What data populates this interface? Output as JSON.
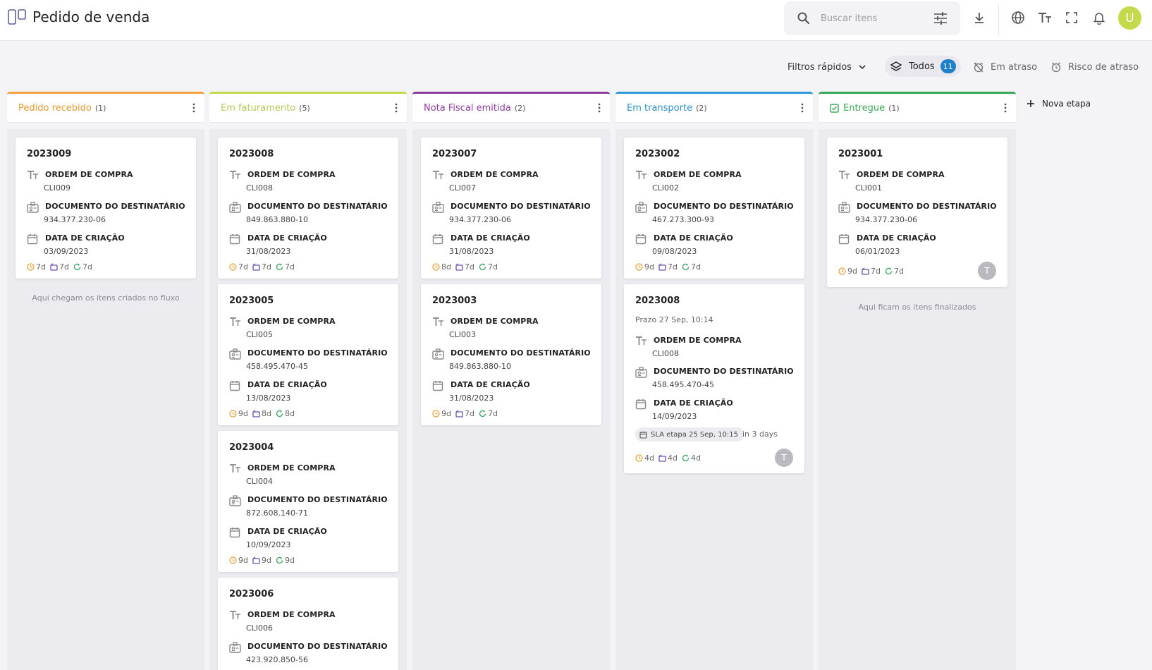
{
  "header": {
    "title": "Pedido de venda",
    "search_placeholder": "Buscar itens",
    "user_initial": "U"
  },
  "filters": {
    "quick_filters_label": "Filtros rápidos",
    "all_label": "Todos",
    "all_count": "11",
    "late_label": "Em atraso",
    "risk_label": "Risco de atraso"
  },
  "colors": {
    "pedido_recebido": "#f2a33a",
    "em_faturamento": "#c5d94a",
    "nota_fiscal": "#8e3f9e",
    "em_transporte": "#2d9bd6",
    "entregue": "#3aa85a",
    "accent_blue": "#1f7fc9"
  },
  "field_labels": {
    "order": "ORDEM DE COMPRA",
    "document": "DOCUMENTO DO DESTINATÁRIO",
    "created": "DATA DE CRIAÇÃO"
  },
  "columns": [
    {
      "title": "Pedido recebido",
      "count": "(1)",
      "hint": "Aqui chegam os itens criados no fluxo",
      "cards": [
        {
          "id": "2023009",
          "order": "CLI009",
          "document": "934.377.230-06",
          "created": "03/09/2023",
          "stats": [
            "7d",
            "7d",
            "7d"
          ]
        }
      ]
    },
    {
      "title": "Em faturamento",
      "count": "(5)",
      "cards": [
        {
          "id": "2023008",
          "order": "CLI008",
          "document": "849.863.880-10",
          "created": "31/08/2023",
          "stats": [
            "7d",
            "7d",
            "7d"
          ]
        },
        {
          "id": "2023005",
          "order": "CLI005",
          "document": "458.495.470-45",
          "created": "13/08/2023",
          "stats": [
            "9d",
            "8d",
            "8d"
          ]
        },
        {
          "id": "2023004",
          "order": "CLI004",
          "document": "872.608.140-71",
          "created": "10/09/2023",
          "stats": [
            "9d",
            "9d",
            "9d"
          ]
        },
        {
          "id": "2023006",
          "order": "CLI006",
          "document": "423.920.850-56",
          "created": "",
          "stats": []
        }
      ]
    },
    {
      "title": "Nota Fiscal emitida",
      "count": "(2)",
      "cards": [
        {
          "id": "2023007",
          "order": "CLI007",
          "document": "934.377.230-06",
          "created": "31/08/2023",
          "stats": [
            "8d",
            "7d",
            "7d"
          ]
        },
        {
          "id": "2023003",
          "order": "CLI003",
          "document": "849.863.880-10",
          "created": "31/08/2023",
          "stats": [
            "9d",
            "7d",
            "7d"
          ]
        }
      ]
    },
    {
      "title": "Em transporte",
      "count": "(2)",
      "cards": [
        {
          "id": "2023002",
          "order": "CLI002",
          "document": "467.273.300-93",
          "created": "09/08/2023",
          "stats": [
            "9d",
            "7d",
            "7d"
          ]
        },
        {
          "id": "2023008",
          "prazo": "Prazo 27 Sep, 10:14",
          "order": "CLI008",
          "document": "458.495.470-45",
          "created": "14/09/2023",
          "sla": "SLA etapa 25 Sep, 10:15",
          "sla_in": "in 3 days",
          "stats": [
            "4d",
            "4d",
            "4d"
          ],
          "avatar": "T"
        }
      ]
    },
    {
      "title": "Entregue",
      "count": "(1)",
      "hint": "Aqui ficam os itens finalizados",
      "cards": [
        {
          "id": "2023001",
          "order": "CLI001",
          "document": "934.377.230-06",
          "created": "06/01/2023",
          "stats": [
            "9d",
            "7d",
            "7d"
          ],
          "avatar": "T"
        }
      ]
    }
  ],
  "new_stage_label": "Nova etapa"
}
